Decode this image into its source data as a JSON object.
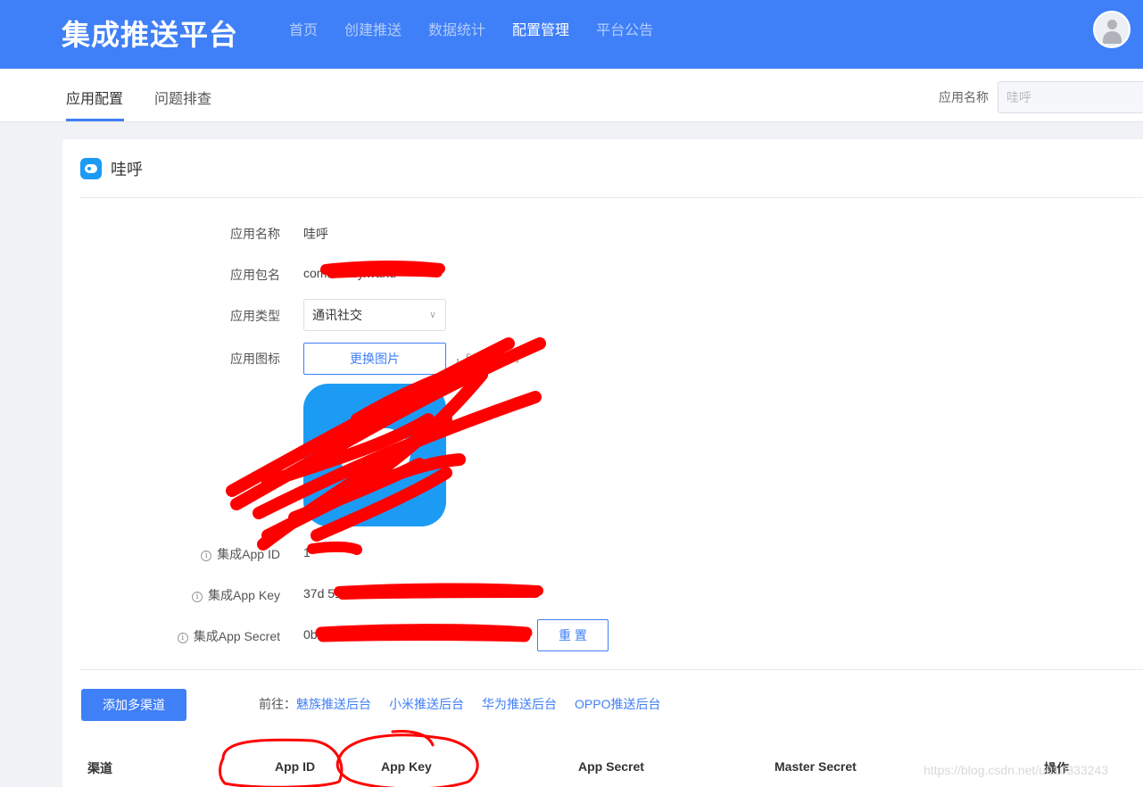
{
  "header": {
    "brand": "集成推送平台",
    "nav": [
      {
        "label": "首页",
        "active": false
      },
      {
        "label": "创建推送",
        "active": false
      },
      {
        "label": "数据统计",
        "active": false
      },
      {
        "label": "配置管理",
        "active": true
      },
      {
        "label": "平台公告",
        "active": false
      }
    ]
  },
  "subnav": {
    "tabs": [
      {
        "label": "应用配置",
        "active": true
      },
      {
        "label": "问题排查",
        "active": false
      }
    ],
    "app_name_label": "应用名称",
    "app_name_placeholder": "哇呼"
  },
  "card": {
    "title": "哇呼",
    "fields": {
      "app_name_label": "应用名称",
      "app_name_value": "哇呼",
      "package_label": "应用包名",
      "package_value": "com.    .easy.wahu",
      "type_label": "应用类型",
      "type_value": "通讯社交",
      "icon_label": "应用图标",
      "change_icon_button": "更换图片",
      "icon_hint": "，500KB以内",
      "app_id_label": "集成App ID",
      "app_id_value": "1      ",
      "app_key_label": "集成App Key",
      "app_key_value": "37d                    518a1f072e90afa7",
      "app_secret_label": "集成App Secret",
      "app_secret_value": "0b                                 0922",
      "reset_button": "重 置"
    },
    "add_channel_button": "添加多渠道",
    "goto_label": "前往：",
    "goto_links": [
      "魅族推送后台",
      "小米推送后台",
      "华为推送后台",
      "OPPO推送后台"
    ],
    "table_headers": [
      "渠道",
      "App ID",
      "App Key",
      "App Secret",
      "Master Secret",
      "操作"
    ]
  },
  "watermark": "https://blog.csdn.net/u010333243",
  "colors": {
    "primary": "#3f7ff7",
    "annotation": "#ff0000"
  }
}
